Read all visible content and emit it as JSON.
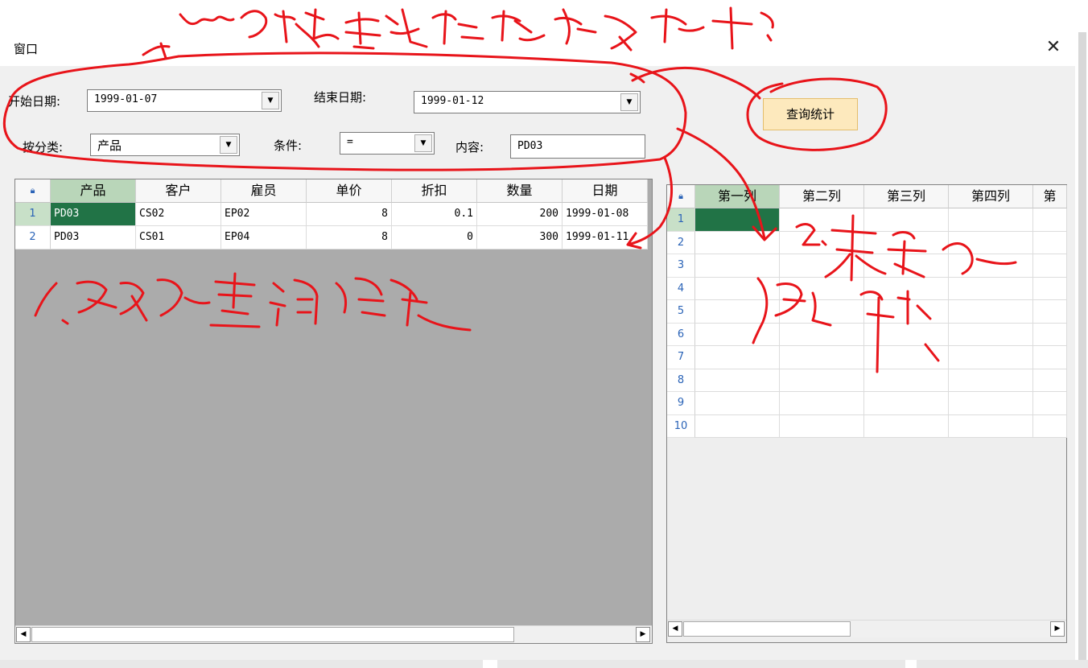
{
  "window": {
    "title": "窗口",
    "close_glyph": "✕"
  },
  "form": {
    "start_date_label": "开始日期:",
    "start_date_value": "1999-01-07",
    "end_date_label": "结束日期:",
    "end_date_value": "1999-01-12",
    "category_label": "按分类:",
    "category_value": "产品",
    "condition_label": "条件:",
    "condition_value": "=",
    "content_label": "内容:",
    "content_value": "PD03",
    "query_button": "查询统计",
    "dropdown_glyph": "▼"
  },
  "left_grid": {
    "corner_icon": "lock-icon",
    "columns": [
      "产品",
      "客户",
      "雇员",
      "单价",
      "折扣",
      "数量",
      "日期"
    ],
    "rows": [
      {
        "num": "1",
        "cells": [
          "PD03",
          "CS02",
          "EP02",
          "8",
          "0.1",
          "200",
          "1999-01-08"
        ]
      },
      {
        "num": "2",
        "cells": [
          "PD03",
          "CS01",
          "EP04",
          "8",
          "0",
          "300",
          "1999-01-11"
        ]
      }
    ]
  },
  "right_grid": {
    "corner_icon": "lock-icon",
    "columns": [
      "第一列",
      "第二列",
      "第三列",
      "第四列",
      "第"
    ],
    "row_numbers": [
      "1",
      "2",
      "3",
      "4",
      "5",
      "6",
      "7",
      "8",
      "9",
      "10"
    ]
  },
  "scrollbar": {
    "left_glyph": "◀",
    "right_glyph": "▶"
  },
  "colors": {
    "selected_cell": "#217346",
    "annotation_ink": "#e8141a",
    "button_fill": "#fde9bd"
  }
}
